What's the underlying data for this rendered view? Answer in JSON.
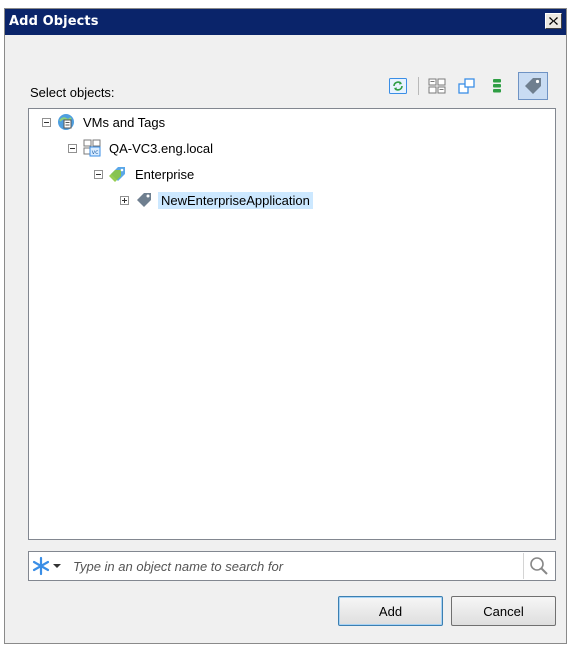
{
  "window": {
    "title": "Add Objects",
    "close_glyph": "X"
  },
  "select_label": "Select objects:",
  "toolbar": {
    "buttons": [
      {
        "name": "refresh-icon",
        "active": false
      },
      {
        "name": "hosts-and-clusters-icon",
        "active": false
      },
      {
        "name": "vms-and-templates-icon",
        "active": false
      },
      {
        "name": "datastores-icon",
        "active": false
      },
      {
        "name": "vms-and-tags-icon",
        "active": true
      }
    ]
  },
  "tree": {
    "nodes": [
      {
        "label": "VMs and Tags",
        "level": 0,
        "expanded": true,
        "icon": "vms-and-tags-root-icon",
        "selected": false
      },
      {
        "label": "QA-VC3.eng.local",
        "level": 1,
        "expanded": true,
        "icon": "vcenter-server-icon",
        "selected": false
      },
      {
        "label": "Enterprise",
        "level": 2,
        "expanded": true,
        "icon": "tag-category-icon",
        "selected": false
      },
      {
        "label": "NewEnterpriseApplication",
        "level": 3,
        "expanded": false,
        "icon": "tag-icon",
        "selected": true
      }
    ]
  },
  "search": {
    "placeholder": "Type in an object name to search for",
    "value": ""
  },
  "buttons": {
    "add_label": "Add",
    "cancel_label": "Cancel"
  },
  "colors": {
    "titlebar": "#0a246a",
    "selection": "#cce8ff",
    "scope_icon": "#3a8ee6"
  }
}
